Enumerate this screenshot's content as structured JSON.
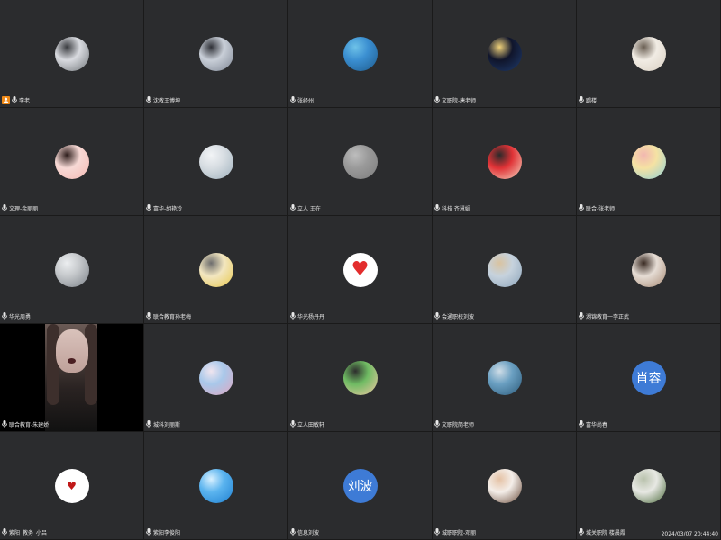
{
  "participants": [
    {
      "name": "李老",
      "host": true,
      "avatar": {
        "style": "photo",
        "colors": [
          "#d9dbe0",
          "#6f7478",
          "#3a3c40"
        ]
      }
    },
    {
      "name": "沈教王博坤",
      "avatar": {
        "style": "photo",
        "colors": [
          "#c9cfd8",
          "#7d8593",
          "#2e3036"
        ]
      }
    },
    {
      "name": "张经州",
      "avatar": {
        "style": "photo",
        "colors": [
          "#3b8fd1",
          "#1d5a8c",
          "#6ec2e8"
        ]
      }
    },
    {
      "name": "文职院-唐老师",
      "avatar": {
        "style": "photo",
        "colors": [
          "#10152b",
          "#1f3c6e",
          "#f0d27a"
        ]
      }
    },
    {
      "name": "踢楼",
      "avatar": {
        "style": "photo",
        "colors": [
          "#f1ece4",
          "#d8cfc2",
          "#6a5f53"
        ]
      }
    },
    {
      "name": "文理-余丽丽",
      "avatar": {
        "style": "photo",
        "colors": [
          "#f7d9d5",
          "#f4b9b3",
          "#2d1d1b"
        ]
      }
    },
    {
      "name": "富华-胡艳玲",
      "avatar": {
        "style": "photo",
        "colors": [
          "#d7dde2",
          "#9fb1bd",
          "#f2f4f6"
        ]
      }
    },
    {
      "name": "立人 王在",
      "avatar": {
        "style": "photo",
        "colors": [
          "#9a9a9a",
          "#7c7c7c",
          "#bdbdbd"
        ]
      }
    },
    {
      "name": "科技 齐慧娟",
      "avatar": {
        "style": "photo",
        "colors": [
          "#e03236",
          "#f5d7c2",
          "#2a2a2a"
        ]
      }
    },
    {
      "name": "联合-张老师",
      "avatar": {
        "style": "photo",
        "colors": [
          "#f5e2a3",
          "#8fd2d8",
          "#f2b7b1"
        ]
      }
    },
    {
      "name": "华光周勇",
      "avatar": {
        "style": "photo",
        "colors": [
          "#c5c8cb",
          "#7a8087",
          "#eceef0"
        ]
      }
    },
    {
      "name": "联合教育孙老梅",
      "avatar": {
        "style": "photo",
        "colors": [
          "#f2e6c0",
          "#e8c84d",
          "#6d6d6d"
        ]
      }
    },
    {
      "name": "华光杨丹丹",
      "avatar": {
        "style": "heart-big",
        "colors": [
          "#ffffff",
          "#e32d2d",
          "#ffffff"
        ]
      }
    },
    {
      "name": "会通职校刘波",
      "avatar": {
        "style": "photo",
        "colors": [
          "#c6d2dd",
          "#8da5bb",
          "#d9c3a0"
        ]
      }
    },
    {
      "name": "湖锦教育一李正武",
      "avatar": {
        "style": "photo",
        "colors": [
          "#e6ddd5",
          "#a78a74",
          "#3a2b23"
        ]
      }
    },
    {
      "name": "联合教育-朱建娇",
      "video": true
    },
    {
      "name": "城科刘丽斯",
      "avatar": {
        "style": "photo",
        "colors": [
          "#a9c8ea",
          "#e1a6c0",
          "#f0e5ef"
        ]
      }
    },
    {
      "name": "立人田敏轩",
      "avatar": {
        "style": "photo",
        "colors": [
          "#6fbb63",
          "#f5c9a6",
          "#2d2d2d"
        ]
      }
    },
    {
      "name": "文职院简老师",
      "avatar": {
        "style": "photo",
        "colors": [
          "#6a9fc1",
          "#2c5b7b",
          "#cfdde7"
        ]
      }
    },
    {
      "name": "富华尚春",
      "avatar": {
        "style": "text",
        "colors": [
          "#3e7bd6",
          "#3e7bd6",
          "#3e7bd6"
        ],
        "text": "肖容"
      }
    },
    {
      "name": "紫阳_教务_小吕",
      "avatar": {
        "style": "heart-small",
        "colors": [
          "#ffffff",
          "#c01818",
          "#ffffff"
        ]
      }
    },
    {
      "name": "紫阳李俊阳",
      "avatar": {
        "style": "photo",
        "colors": [
          "#5bb4ef",
          "#1e7fd0",
          "#d9f1ff"
        ]
      }
    },
    {
      "name": "信息刘波",
      "avatar": {
        "style": "text",
        "colors": [
          "#3e7bd6",
          "#3e7bd6",
          "#3e7bd6"
        ],
        "text": "刘波"
      }
    },
    {
      "name": "城职职院-邓丽",
      "avatar": {
        "style": "photo",
        "colors": [
          "#f4eee9",
          "#6a4b3a",
          "#e5c2a5"
        ]
      }
    },
    {
      "name": "城关职院 楼晨霞",
      "avatar": {
        "style": "photo",
        "colors": [
          "#e7e8e3",
          "#4c6b3c",
          "#b9c2ad"
        ]
      }
    }
  ],
  "timestamp": "2024/03/07 20:44:40"
}
